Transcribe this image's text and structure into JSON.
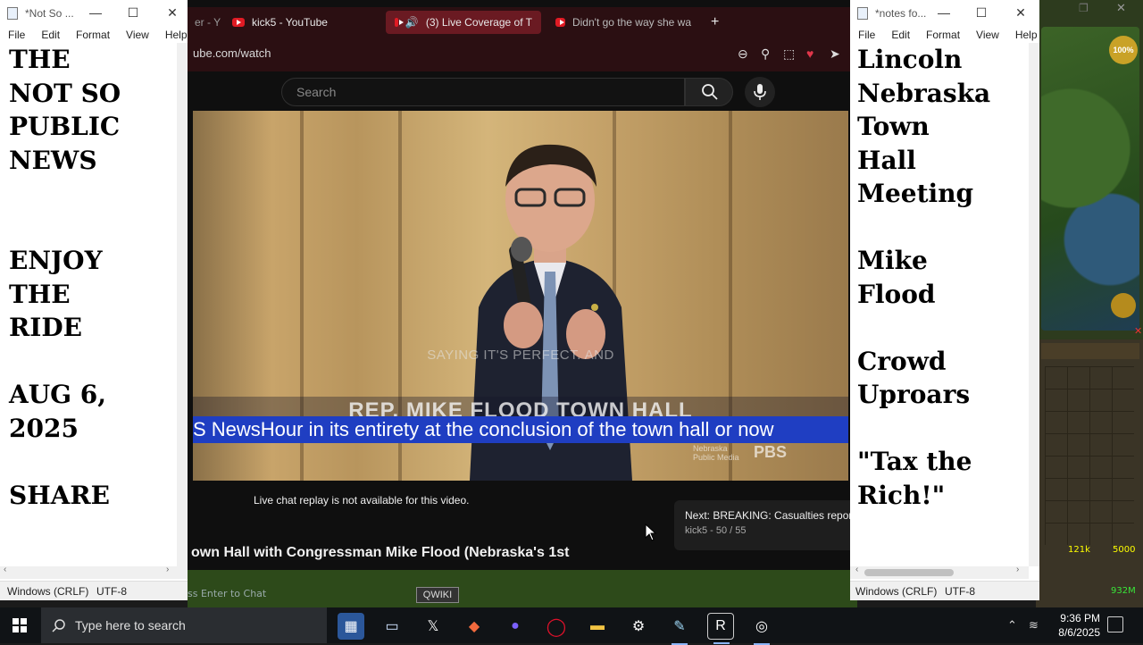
{
  "game": {
    "compass_pct": "100%",
    "stack1": "121k",
    "stack2": "5000",
    "gold": "932M"
  },
  "browser": {
    "tabs": [
      {
        "label": "er - Y"
      },
      {
        "label": "kick5 - YouTube"
      },
      {
        "label": "(3) Live Coverage of T"
      },
      {
        "label": "Didn't go the way she wa"
      }
    ],
    "new_tab": "+",
    "url": "ube.com/watch",
    "search_placeholder": "Search",
    "video": {
      "caption": "SAYING IT'S PERFECT. AND",
      "lower_third": "REP. MIKE FLOOD TOWN HALL",
      "ticker": "S NewsHour in its entirety at the conclusion of the town hall or now",
      "network_small": "Nebraska Public Media",
      "network": "PBS"
    },
    "chat_note": "Live chat replay is not available for this video.",
    "next_card": {
      "title": "Next: BREAKING: Casualties report",
      "subtitle": "kick5 - 50 / 55"
    },
    "video_title": "own Hall with Congressman Mike Flood (Nebraska's 1st",
    "chat_input": "ss Enter to Chat",
    "qwiki": "QWIKI"
  },
  "notepad_left": {
    "title": "*Not So ...",
    "menu": [
      "File",
      "Edit",
      "Format",
      "View",
      "Help"
    ],
    "lines": [
      "THE",
      "NOT SO",
      "PUBLIC",
      "NEWS",
      "",
      "",
      "ENJOY",
      "THE",
      "RIDE",
      "",
      "AUG 6,",
      "2025",
      "",
      "SHARE"
    ],
    "status_eol": "Windows (CRLF)",
    "status_enc": "UTF-8"
  },
  "notepad_right": {
    "title": "*notes fo...",
    "menu": [
      "File",
      "Edit",
      "Format",
      "View",
      "Help"
    ],
    "lines": [
      "Lincoln",
      "Nebraska",
      "Town",
      "Hall",
      "Meeting",
      "",
      "Mike",
      "Flood",
      "",
      "Crowd",
      "Uproars",
      "",
      "\"Tax the",
      "Rich!\""
    ],
    "status_eol": "Windows (CRLF)",
    "status_enc": "UTF-8"
  },
  "taskbar": {
    "search_placeholder": "Type here to search",
    "time": "9:36 PM",
    "date": "8/6/2025"
  }
}
